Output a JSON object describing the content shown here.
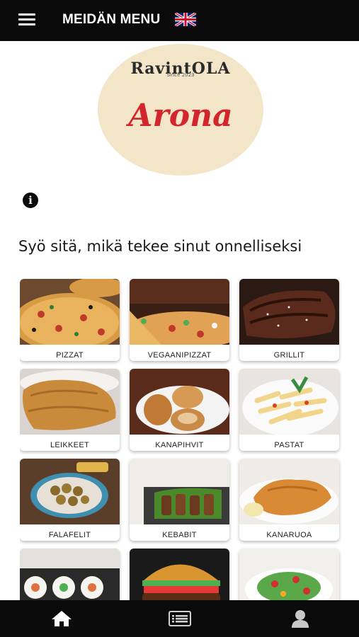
{
  "header": {
    "title": "MEIDÄN MENU",
    "menu_icon": "hamburger-menu-icon",
    "language_flag": "uk-flag-icon"
  },
  "logo": {
    "top_text": "RavintOLA",
    "since_text": "Since 2023",
    "name": "Arona"
  },
  "info_icon": "info-icon",
  "tagline": "Syö sitä, mikä tekee sinut onnelliseksi",
  "categories": [
    {
      "label": "PIZZAT",
      "image": "pizza-photo"
    },
    {
      "label": "VEGAANIPIZZAT",
      "image": "vegan-pizza-photo"
    },
    {
      "label": "GRILLIT",
      "image": "grilled-steak-photo"
    },
    {
      "label": "LEIKKEET",
      "image": "schnitzel-photo"
    },
    {
      "label": "KANAPIHVIT",
      "image": "chicken-patty-photo"
    },
    {
      "label": "PASTAT",
      "image": "pasta-photo"
    },
    {
      "label": "FALAFELIT",
      "image": "falafel-photo"
    },
    {
      "label": "KEBABIT",
      "image": "kebab-photo"
    },
    {
      "label": "KANARUOA",
      "image": "roast-chicken-photo"
    },
    {
      "label": "",
      "image": "sushi-photo"
    },
    {
      "label": "",
      "image": "burger-photo"
    },
    {
      "label": "",
      "image": "salad-photo"
    }
  ],
  "bottom_nav": [
    {
      "icon": "home-icon"
    },
    {
      "icon": "menu-list-icon"
    },
    {
      "icon": "user-icon"
    }
  ],
  "colors": {
    "bar": "#0a0a0a",
    "logo_bg": "#f3e6c8",
    "logo_red": "#d2262c"
  }
}
